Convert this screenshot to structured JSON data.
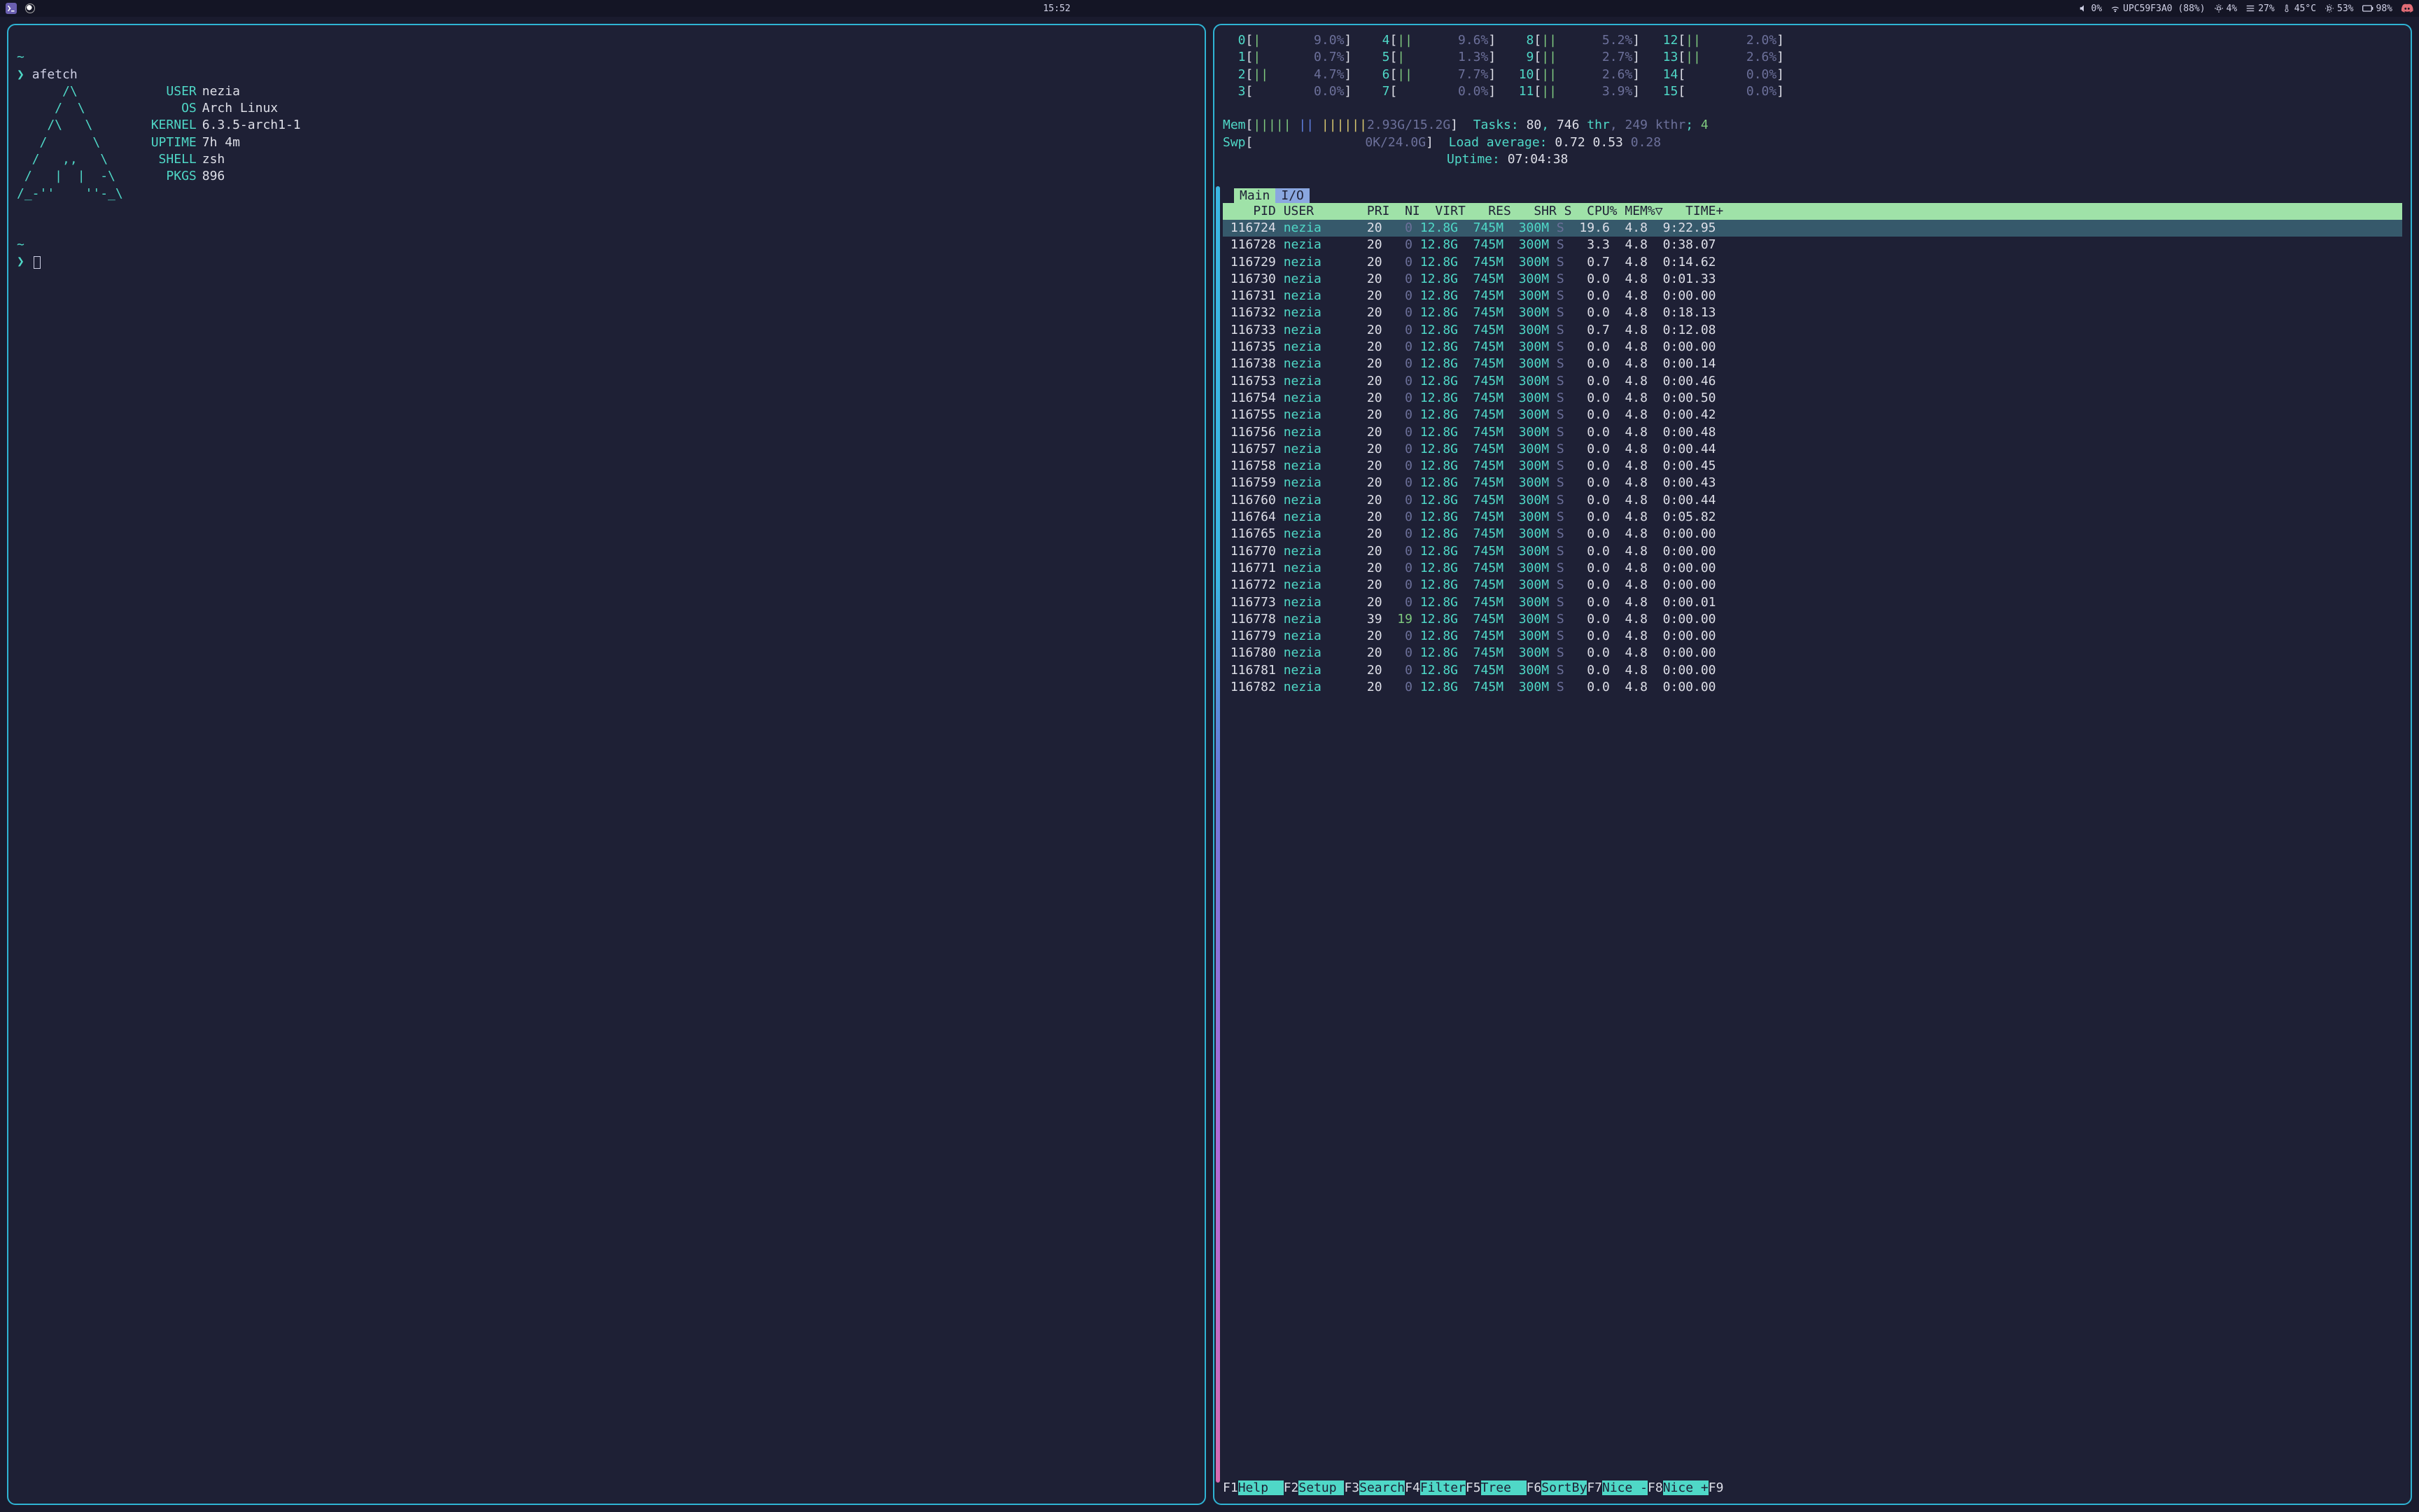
{
  "topbar": {
    "clock": "15:52",
    "volume": "0%",
    "wifi": "UPC59F3A0 (88%)",
    "cpu": "4%",
    "disk": "27%",
    "temp": "45°C",
    "fan": "53%",
    "battery": "98%"
  },
  "left": {
    "prompt_symbol": "❯",
    "command": "afetch",
    "ascii": "      /\\\n     /  \\\n    /\\   \\\n   /      \\\n  /   ,,   \\\n /   |  |  -\\\n/_-''    ''-_\\",
    "info": {
      "USER": "nezia",
      "OS": "Arch Linux",
      "KERNEL": "6.3.5-arch1-1",
      "UPTIME": "7h 4m",
      "SHELL": "zsh",
      "PKGS": "896"
    }
  },
  "htop": {
    "cpus": [
      {
        "n": "0",
        "bar": "|",
        "pct": "9.0%"
      },
      {
        "n": "1",
        "bar": "|",
        "pct": "0.7%"
      },
      {
        "n": "2",
        "bar": "||",
        "pct": "4.7%"
      },
      {
        "n": "3",
        "bar": "",
        "pct": "0.0%"
      },
      {
        "n": "4",
        "bar": "||",
        "pct": "9.6%"
      },
      {
        "n": "5",
        "bar": "|",
        "pct": "1.3%"
      },
      {
        "n": "6",
        "bar": "||",
        "pct": "7.7%"
      },
      {
        "n": "7",
        "bar": "",
        "pct": "0.0%"
      },
      {
        "n": "8",
        "bar": "||",
        "pct": "5.2%"
      },
      {
        "n": "9",
        "bar": "||",
        "pct": "2.7%"
      },
      {
        "n": "10",
        "bar": "||",
        "pct": "2.6%"
      },
      {
        "n": "11",
        "bar": "||",
        "pct": "3.9%"
      },
      {
        "n": "12",
        "bar": "||",
        "pct": "2.0%"
      },
      {
        "n": "13",
        "bar": "||",
        "pct": "2.6%"
      },
      {
        "n": "14",
        "bar": "",
        "pct": "0.0%"
      },
      {
        "n": "15",
        "bar": "",
        "pct": "0.0%"
      }
    ],
    "mem_used": "2.93G",
    "mem_total": "15.2G",
    "swp_used": "0K",
    "swp_total": "24.0G",
    "tasks": {
      "procs": "80",
      "thr": "746",
      "kthr": "249",
      "running": "4"
    },
    "load": [
      "0.72",
      "0.53",
      "0.28"
    ],
    "uptime": "07:04:38",
    "tab_main": "Main",
    "tab_io": "I/O",
    "cols": "    PID USER       PRI  NI  VIRT   RES   SHR S  CPU% MEM%▽   TIME+",
    "rows": [
      {
        "pid": "116724",
        "user": "nezia",
        "pri": "20",
        "ni": "0",
        "virt": "12.8G",
        "res": "745M",
        "shr": "300M",
        "s": "S",
        "cpu": "19.6",
        "mem": "4.8",
        "time": "9:22.95",
        "hl": true
      },
      {
        "pid": "116728",
        "user": "nezia",
        "pri": "20",
        "ni": "0",
        "virt": "12.8G",
        "res": "745M",
        "shr": "300M",
        "s": "S",
        "cpu": "3.3",
        "mem": "4.8",
        "time": "0:38.07"
      },
      {
        "pid": "116729",
        "user": "nezia",
        "pri": "20",
        "ni": "0",
        "virt": "12.8G",
        "res": "745M",
        "shr": "300M",
        "s": "S",
        "cpu": "0.7",
        "mem": "4.8",
        "time": "0:14.62"
      },
      {
        "pid": "116730",
        "user": "nezia",
        "pri": "20",
        "ni": "0",
        "virt": "12.8G",
        "res": "745M",
        "shr": "300M",
        "s": "S",
        "cpu": "0.0",
        "mem": "4.8",
        "time": "0:01.33"
      },
      {
        "pid": "116731",
        "user": "nezia",
        "pri": "20",
        "ni": "0",
        "virt": "12.8G",
        "res": "745M",
        "shr": "300M",
        "s": "S",
        "cpu": "0.0",
        "mem": "4.8",
        "time": "0:00.00"
      },
      {
        "pid": "116732",
        "user": "nezia",
        "pri": "20",
        "ni": "0",
        "virt": "12.8G",
        "res": "745M",
        "shr": "300M",
        "s": "S",
        "cpu": "0.0",
        "mem": "4.8",
        "time": "0:18.13"
      },
      {
        "pid": "116733",
        "user": "nezia",
        "pri": "20",
        "ni": "0",
        "virt": "12.8G",
        "res": "745M",
        "shr": "300M",
        "s": "S",
        "cpu": "0.7",
        "mem": "4.8",
        "time": "0:12.08"
      },
      {
        "pid": "116735",
        "user": "nezia",
        "pri": "20",
        "ni": "0",
        "virt": "12.8G",
        "res": "745M",
        "shr": "300M",
        "s": "S",
        "cpu": "0.0",
        "mem": "4.8",
        "time": "0:00.00"
      },
      {
        "pid": "116738",
        "user": "nezia",
        "pri": "20",
        "ni": "0",
        "virt": "12.8G",
        "res": "745M",
        "shr": "300M",
        "s": "S",
        "cpu": "0.0",
        "mem": "4.8",
        "time": "0:00.14"
      },
      {
        "pid": "116753",
        "user": "nezia",
        "pri": "20",
        "ni": "0",
        "virt": "12.8G",
        "res": "745M",
        "shr": "300M",
        "s": "S",
        "cpu": "0.0",
        "mem": "4.8",
        "time": "0:00.46"
      },
      {
        "pid": "116754",
        "user": "nezia",
        "pri": "20",
        "ni": "0",
        "virt": "12.8G",
        "res": "745M",
        "shr": "300M",
        "s": "S",
        "cpu": "0.0",
        "mem": "4.8",
        "time": "0:00.50"
      },
      {
        "pid": "116755",
        "user": "nezia",
        "pri": "20",
        "ni": "0",
        "virt": "12.8G",
        "res": "745M",
        "shr": "300M",
        "s": "S",
        "cpu": "0.0",
        "mem": "4.8",
        "time": "0:00.42"
      },
      {
        "pid": "116756",
        "user": "nezia",
        "pri": "20",
        "ni": "0",
        "virt": "12.8G",
        "res": "745M",
        "shr": "300M",
        "s": "S",
        "cpu": "0.0",
        "mem": "4.8",
        "time": "0:00.48"
      },
      {
        "pid": "116757",
        "user": "nezia",
        "pri": "20",
        "ni": "0",
        "virt": "12.8G",
        "res": "745M",
        "shr": "300M",
        "s": "S",
        "cpu": "0.0",
        "mem": "4.8",
        "time": "0:00.44"
      },
      {
        "pid": "116758",
        "user": "nezia",
        "pri": "20",
        "ni": "0",
        "virt": "12.8G",
        "res": "745M",
        "shr": "300M",
        "s": "S",
        "cpu": "0.0",
        "mem": "4.8",
        "time": "0:00.45"
      },
      {
        "pid": "116759",
        "user": "nezia",
        "pri": "20",
        "ni": "0",
        "virt": "12.8G",
        "res": "745M",
        "shr": "300M",
        "s": "S",
        "cpu": "0.0",
        "mem": "4.8",
        "time": "0:00.43"
      },
      {
        "pid": "116760",
        "user": "nezia",
        "pri": "20",
        "ni": "0",
        "virt": "12.8G",
        "res": "745M",
        "shr": "300M",
        "s": "S",
        "cpu": "0.0",
        "mem": "4.8",
        "time": "0:00.44"
      },
      {
        "pid": "116764",
        "user": "nezia",
        "pri": "20",
        "ni": "0",
        "virt": "12.8G",
        "res": "745M",
        "shr": "300M",
        "s": "S",
        "cpu": "0.0",
        "mem": "4.8",
        "time": "0:05.82"
      },
      {
        "pid": "116765",
        "user": "nezia",
        "pri": "20",
        "ni": "0",
        "virt": "12.8G",
        "res": "745M",
        "shr": "300M",
        "s": "S",
        "cpu": "0.0",
        "mem": "4.8",
        "time": "0:00.00"
      },
      {
        "pid": "116770",
        "user": "nezia",
        "pri": "20",
        "ni": "0",
        "virt": "12.8G",
        "res": "745M",
        "shr": "300M",
        "s": "S",
        "cpu": "0.0",
        "mem": "4.8",
        "time": "0:00.00"
      },
      {
        "pid": "116771",
        "user": "nezia",
        "pri": "20",
        "ni": "0",
        "virt": "12.8G",
        "res": "745M",
        "shr": "300M",
        "s": "S",
        "cpu": "0.0",
        "mem": "4.8",
        "time": "0:00.00"
      },
      {
        "pid": "116772",
        "user": "nezia",
        "pri": "20",
        "ni": "0",
        "virt": "12.8G",
        "res": "745M",
        "shr": "300M",
        "s": "S",
        "cpu": "0.0",
        "mem": "4.8",
        "time": "0:00.00"
      },
      {
        "pid": "116773",
        "user": "nezia",
        "pri": "20",
        "ni": "0",
        "virt": "12.8G",
        "res": "745M",
        "shr": "300M",
        "s": "S",
        "cpu": "0.0",
        "mem": "4.8",
        "time": "0:00.01"
      },
      {
        "pid": "116778",
        "user": "nezia",
        "pri": "39",
        "ni": "19",
        "virt": "12.8G",
        "res": "745M",
        "shr": "300M",
        "s": "S",
        "cpu": "0.0",
        "mem": "4.8",
        "time": "0:00.00"
      },
      {
        "pid": "116779",
        "user": "nezia",
        "pri": "20",
        "ni": "0",
        "virt": "12.8G",
        "res": "745M",
        "shr": "300M",
        "s": "S",
        "cpu": "0.0",
        "mem": "4.8",
        "time": "0:00.00"
      },
      {
        "pid": "116780",
        "user": "nezia",
        "pri": "20",
        "ni": "0",
        "virt": "12.8G",
        "res": "745M",
        "shr": "300M",
        "s": "S",
        "cpu": "0.0",
        "mem": "4.8",
        "time": "0:00.00"
      },
      {
        "pid": "116781",
        "user": "nezia",
        "pri": "20",
        "ni": "0",
        "virt": "12.8G",
        "res": "745M",
        "shr": "300M",
        "s": "S",
        "cpu": "0.0",
        "mem": "4.8",
        "time": "0:00.00"
      },
      {
        "pid": "116782",
        "user": "nezia",
        "pri": "20",
        "ni": "0",
        "virt": "12.8G",
        "res": "745M",
        "shr": "300M",
        "s": "S",
        "cpu": "0.0",
        "mem": "4.8",
        "time": "0:00.00"
      }
    ],
    "footer": [
      {
        "key": "F1",
        "lbl": "Help  "
      },
      {
        "key": "F2",
        "lbl": "Setup "
      },
      {
        "key": "F3",
        "lbl": "Search"
      },
      {
        "key": "F4",
        "lbl": "Filter"
      },
      {
        "key": "F5",
        "lbl": "Tree  "
      },
      {
        "key": "F6",
        "lbl": "SortBy"
      },
      {
        "key": "F7",
        "lbl": "Nice -"
      },
      {
        "key": "F8",
        "lbl": "Nice +"
      },
      {
        "key": "F9",
        "lbl": ""
      }
    ]
  }
}
